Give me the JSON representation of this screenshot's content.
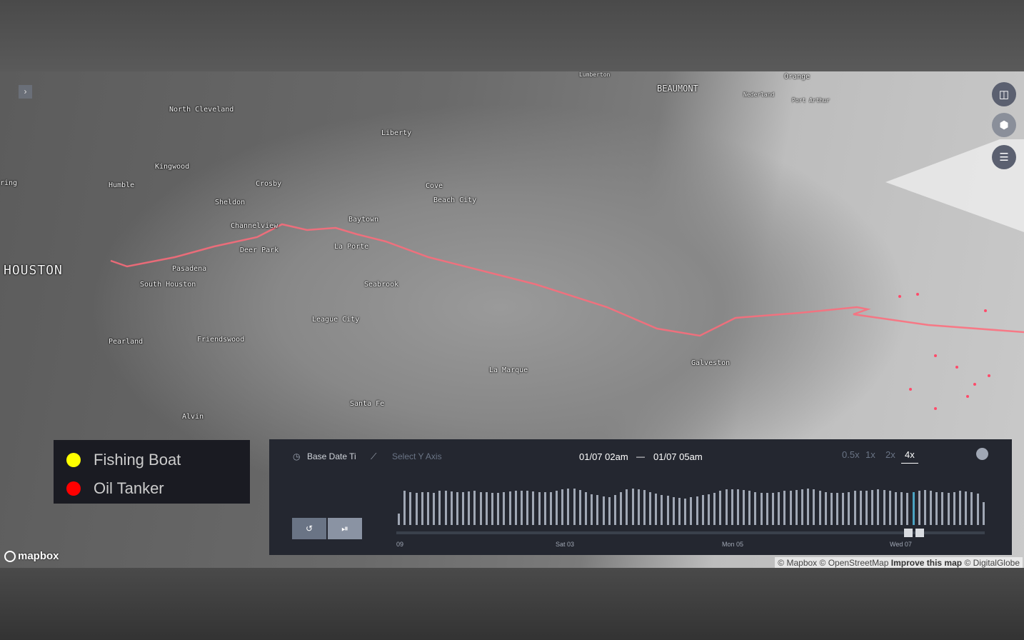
{
  "map": {
    "labels": [
      "HOUSTON",
      "BEAUMONT",
      "North Cleveland",
      "Liberty",
      "Kingwood",
      "Humble",
      "Crosby",
      "Sheldon",
      "Channelview",
      "Baytown",
      "Deer Park",
      "La Porte",
      "Pasadena",
      "South Houston",
      "Seabrook",
      "League City",
      "Pearland",
      "Friendswood",
      "La Marque",
      "Galveston",
      "Santa Fe",
      "Alvin",
      "Cove",
      "Beach City",
      "Nederland",
      "Port Arthur",
      "Lumberton",
      "Orange",
      "ring"
    ],
    "route_color": "#ff6b7a"
  },
  "controls": {
    "sidebar_toggle": "›",
    "split_icon": "split-map-icon",
    "3d_icon": "cube-icon",
    "legend_icon": "legend-list-icon"
  },
  "legend": {
    "items": [
      {
        "label": "Fishing Boat",
        "color": "#ffff00"
      },
      {
        "label": "Oil Tanker",
        "color": "#ff0000"
      }
    ]
  },
  "attribution": {
    "logo": "mapbox",
    "mapbox": "© Mapbox",
    "osm": "© OpenStreetMap",
    "improve": "Improve this map",
    "dg": "© DigitalGlobe"
  },
  "timeline": {
    "field": "Base Date Ti",
    "y_axis": "Select Y Axis",
    "start": "01/07 02am",
    "dash": "—",
    "end": "01/07 05am",
    "speeds": [
      "0.5x",
      "1x",
      "2x",
      "4x"
    ],
    "active_speed": "4x",
    "reset": "↺",
    "play": "⏯",
    "ticks": [
      "09",
      "Sat 03",
      "Mon 05",
      "Wed 07"
    ],
    "histogram": [
      30,
      88,
      85,
      84,
      86,
      85,
      84,
      88,
      88,
      87,
      85,
      86,
      87,
      88,
      86,
      85,
      84,
      83,
      85,
      87,
      88,
      89,
      88,
      87,
      86,
      85,
      86,
      88,
      92,
      95,
      94,
      90,
      85,
      80,
      78,
      75,
      72,
      78,
      85,
      92,
      95,
      93,
      90,
      86,
      82,
      78,
      76,
      73,
      70,
      69,
      72,
      75,
      78,
      80,
      84,
      88,
      92,
      93,
      92,
      90,
      88,
      85,
      84,
      83,
      84,
      86,
      88,
      88,
      90,
      92,
      94,
      92,
      88,
      85,
      84,
      83,
      84,
      86,
      88,
      88,
      89,
      90,
      93,
      90,
      88,
      86,
      85,
      84,
      86,
      88,
      90,
      88,
      86,
      85,
      84,
      86,
      88,
      87,
      85,
      82,
      60
    ],
    "highlight_index": 88,
    "window_fraction": [
      0.87,
      0.89
    ]
  }
}
